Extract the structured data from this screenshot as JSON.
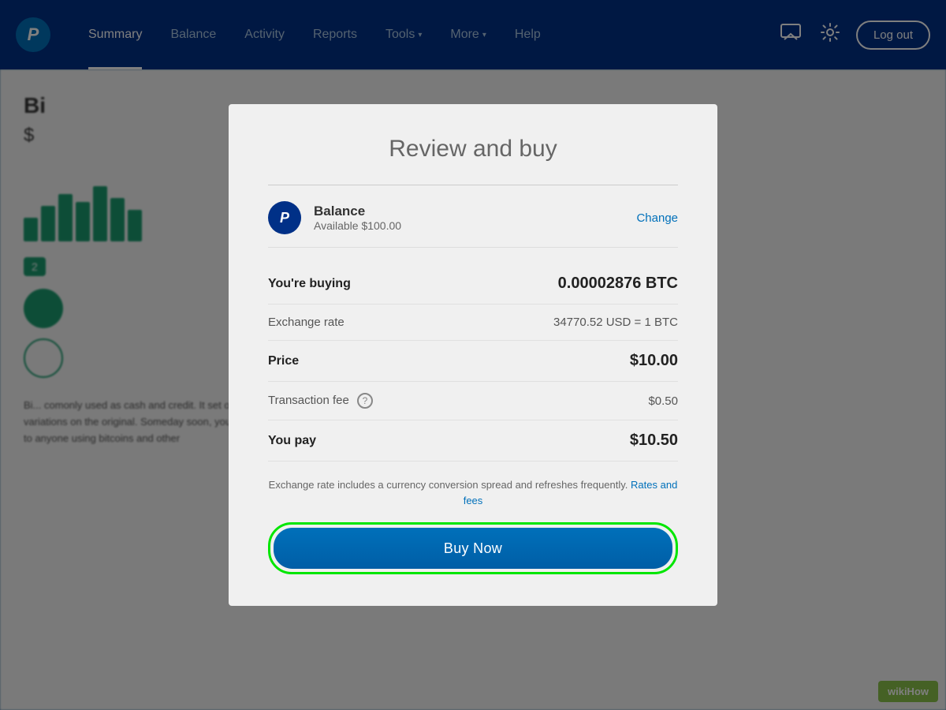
{
  "navbar": {
    "logo_label": "P",
    "links": [
      {
        "label": "Summary",
        "active": true
      },
      {
        "label": "Balance",
        "active": false
      },
      {
        "label": "Activity",
        "active": false
      },
      {
        "label": "Reports",
        "active": false
      },
      {
        "label": "Tools",
        "active": false,
        "has_chevron": true
      },
      {
        "label": "More",
        "active": false,
        "has_chevron": true
      },
      {
        "label": "Help",
        "active": false
      }
    ],
    "logout_label": "Log out"
  },
  "background": {
    "title_prefix": "Bi",
    "price_prefix": "$",
    "badge_text": "2",
    "body_text": "Bi... comonly used as cash and credit. It set off a revolution that has since inspired thousands of variations on the original. Someday soon, you might be able to buy just about anything and send money to anyone using bitcoins and other"
  },
  "modal": {
    "title": "Review and buy",
    "payment_method": {
      "logo": "P",
      "label": "Balance",
      "available": "Available $100.00",
      "change_label": "Change"
    },
    "you_buying_label": "You're buying",
    "you_buying_value": "0.00002876 BTC",
    "exchange_rate_label": "Exchange rate",
    "exchange_rate_value": "34770.52 USD = 1 BTC",
    "price_label": "Price",
    "price_value": "$10.00",
    "transaction_fee_label": "Transaction fee",
    "transaction_fee_value": "$0.50",
    "you_pay_label": "You pay",
    "you_pay_value": "$10.50",
    "footer_text": "Exchange rate includes a currency conversion spread and refreshes frequently.",
    "rates_fees_label": "Rates and fees",
    "buy_now_label": "Buy Now"
  },
  "wikihow": {
    "badge": "wikiHow"
  }
}
